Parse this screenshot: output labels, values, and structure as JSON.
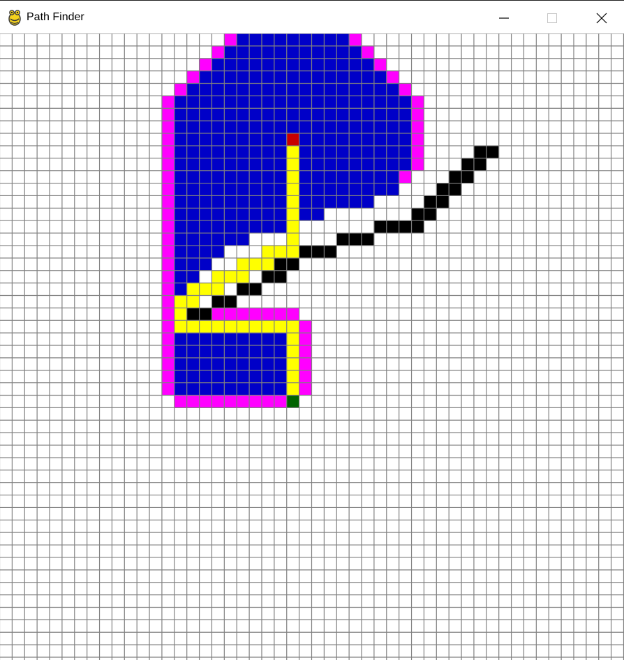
{
  "window": {
    "title": "Path Finder",
    "app_icon": "pygame-snake-icon",
    "controls": [
      "minimize-icon",
      "maximize-icon",
      "close-icon"
    ]
  },
  "grid": {
    "rows": 50,
    "cols": 50,
    "colors": {
      "background": "#ffffff",
      "grid_line": "#808080",
      "visited": "#0000c8",
      "frontier": "#ff00ff",
      "barrier": "#000000",
      "path": "#ffff00",
      "start": "#c80000",
      "end": "#006400"
    },
    "start": [
      8,
      23
    ],
    "end": [
      29,
      23
    ],
    "barriers": [
      [
        9,
        38
      ],
      [
        9,
        39
      ],
      [
        10,
        37
      ],
      [
        10,
        38
      ],
      [
        11,
        36
      ],
      [
        11,
        37
      ],
      [
        12,
        35
      ],
      [
        12,
        36
      ],
      [
        13,
        34
      ],
      [
        13,
        35
      ],
      [
        14,
        33
      ],
      [
        14,
        34
      ],
      [
        15,
        30
      ],
      [
        15,
        31
      ],
      [
        15,
        32
      ],
      [
        15,
        33
      ],
      [
        16,
        27
      ],
      [
        16,
        28
      ],
      [
        16,
        29
      ],
      [
        17,
        24
      ],
      [
        17,
        25
      ],
      [
        17,
        26
      ],
      [
        18,
        22
      ],
      [
        18,
        23
      ],
      [
        19,
        21
      ],
      [
        19,
        22
      ],
      [
        20,
        19
      ],
      [
        20,
        20
      ],
      [
        21,
        17
      ],
      [
        21,
        18
      ],
      [
        22,
        15
      ],
      [
        22,
        16
      ]
    ],
    "frontier": [
      [
        0,
        18
      ],
      [
        0,
        28
      ],
      [
        1,
        17
      ],
      [
        1,
        29
      ],
      [
        2,
        16
      ],
      [
        2,
        30
      ],
      [
        3,
        15
      ],
      [
        3,
        31
      ],
      [
        4,
        14
      ],
      [
        4,
        32
      ],
      [
        5,
        13
      ],
      [
        5,
        33
      ],
      [
        6,
        13
      ],
      [
        6,
        33
      ],
      [
        7,
        13
      ],
      [
        7,
        33
      ],
      [
        8,
        13
      ],
      [
        8,
        33
      ],
      [
        9,
        13
      ],
      [
        9,
        33
      ],
      [
        10,
        13
      ],
      [
        10,
        33
      ],
      [
        11,
        13
      ],
      [
        11,
        32
      ],
      [
        12,
        13
      ],
      [
        13,
        13
      ],
      [
        14,
        13
      ],
      [
        15,
        13
      ],
      [
        16,
        13
      ],
      [
        17,
        13
      ],
      [
        18,
        13
      ],
      [
        19,
        13
      ],
      [
        20,
        13
      ],
      [
        21,
        13
      ],
      [
        22,
        13
      ],
      [
        22,
        17
      ],
      [
        22,
        18
      ],
      [
        22,
        19
      ],
      [
        22,
        20
      ],
      [
        22,
        21
      ],
      [
        22,
        22
      ],
      [
        22,
        23
      ],
      [
        23,
        13
      ],
      [
        23,
        24
      ],
      [
        24,
        13
      ],
      [
        24,
        24
      ],
      [
        25,
        13
      ],
      [
        25,
        24
      ],
      [
        26,
        13
      ],
      [
        26,
        24
      ],
      [
        27,
        13
      ],
      [
        27,
        24
      ],
      [
        28,
        13
      ],
      [
        28,
        24
      ],
      [
        29,
        14
      ],
      [
        29,
        15
      ],
      [
        29,
        16
      ],
      [
        29,
        17
      ],
      [
        29,
        18
      ],
      [
        29,
        19
      ],
      [
        29,
        20
      ],
      [
        29,
        21
      ],
      [
        29,
        22
      ]
    ],
    "visited_ranges": [
      [
        0,
        19,
        27
      ],
      [
        1,
        18,
        28
      ],
      [
        2,
        17,
        29
      ],
      [
        3,
        16,
        30
      ],
      [
        4,
        15,
        31
      ],
      [
        5,
        14,
        32
      ],
      [
        6,
        14,
        32
      ],
      [
        7,
        14,
        32
      ],
      [
        8,
        14,
        32
      ],
      [
        9,
        14,
        32
      ],
      [
        10,
        14,
        32
      ],
      [
        11,
        14,
        31
      ],
      [
        12,
        14,
        31
      ],
      [
        13,
        14,
        29
      ],
      [
        14,
        14,
        25
      ],
      [
        15,
        14,
        22
      ],
      [
        16,
        14,
        19
      ],
      [
        17,
        14,
        17
      ],
      [
        18,
        14,
        16
      ],
      [
        19,
        14,
        15
      ],
      [
        20,
        14,
        14
      ],
      [
        21,
        14,
        14
      ],
      [
        23,
        14,
        23
      ],
      [
        24,
        14,
        23
      ],
      [
        25,
        14,
        23
      ],
      [
        26,
        14,
        23
      ],
      [
        27,
        14,
        23
      ],
      [
        28,
        14,
        23
      ]
    ],
    "path": [
      [
        9,
        23
      ],
      [
        10,
        23
      ],
      [
        11,
        23
      ],
      [
        12,
        23
      ],
      [
        13,
        23
      ],
      [
        14,
        23
      ],
      [
        15,
        23
      ],
      [
        16,
        23
      ],
      [
        17,
        23
      ],
      [
        17,
        22
      ],
      [
        17,
        21
      ],
      [
        18,
        21
      ],
      [
        18,
        20
      ],
      [
        18,
        19
      ],
      [
        19,
        19
      ],
      [
        19,
        18
      ],
      [
        19,
        17
      ],
      [
        20,
        17
      ],
      [
        20,
        16
      ],
      [
        20,
        15
      ],
      [
        21,
        15
      ],
      [
        21,
        14
      ],
      [
        22,
        14
      ],
      [
        23,
        14
      ],
      [
        23,
        15
      ],
      [
        23,
        16
      ],
      [
        23,
        17
      ],
      [
        23,
        18
      ],
      [
        23,
        19
      ],
      [
        23,
        20
      ],
      [
        23,
        21
      ],
      [
        23,
        22
      ],
      [
        23,
        23
      ],
      [
        24,
        23
      ],
      [
        25,
        23
      ],
      [
        26,
        23
      ],
      [
        27,
        23
      ],
      [
        28,
        23
      ]
    ]
  }
}
